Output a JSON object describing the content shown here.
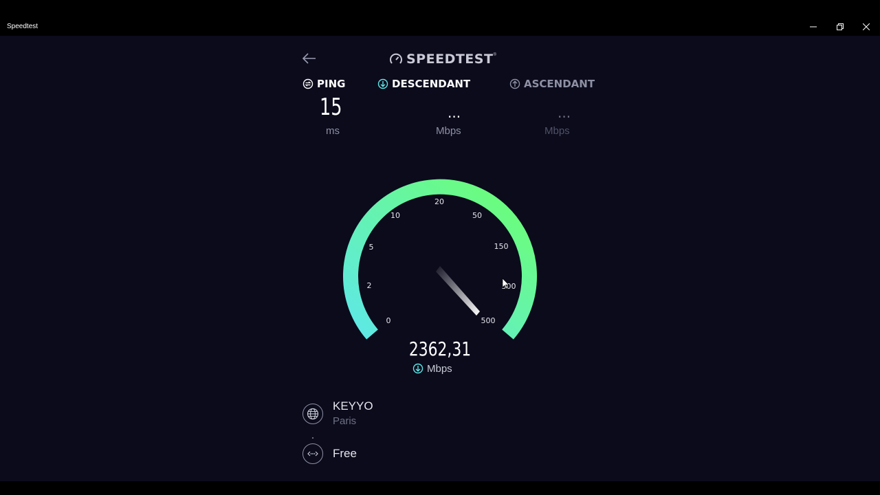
{
  "window": {
    "title": "Speedtest"
  },
  "header": {
    "logo_text": "SPEEDTEST",
    "logo_tm": "®"
  },
  "metrics": {
    "ping": {
      "label": "PING",
      "value": "15",
      "unit": "ms"
    },
    "download": {
      "label": "DESCENDANT",
      "value": "...",
      "unit": "Mbps"
    },
    "upload": {
      "label": "ASCENDANT",
      "value": "...",
      "unit": "Mbps"
    }
  },
  "gauge": {
    "ticks": [
      "0",
      "2",
      "5",
      "10",
      "20",
      "50",
      "150",
      "300",
      "500"
    ],
    "needle_at_tick": "500",
    "current_speed": "2362,31",
    "current_unit": "Mbps"
  },
  "server": {
    "isp": "KEYYO",
    "city": "Paris",
    "provider": "Free"
  },
  "colors": {
    "accent_cyan": "#5ee8e8",
    "accent_green": "#6cff6e",
    "background": "#0b0b1c"
  }
}
